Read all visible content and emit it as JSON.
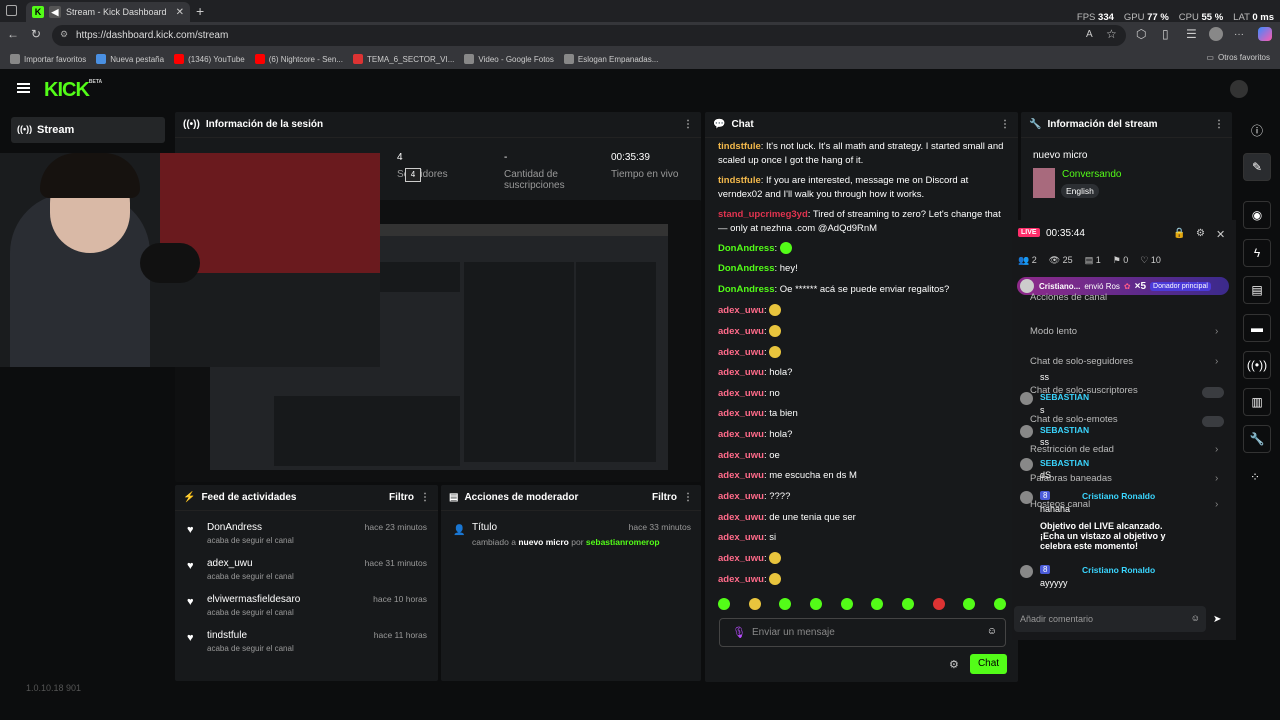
{
  "browser": {
    "tab_title": "Stream - Kick Dashboard",
    "url": "https://dashboard.kick.com/stream",
    "stats": [
      {
        "k": "FPS",
        "v": "334"
      },
      {
        "k": "GPU",
        "v": "77 %"
      },
      {
        "k": "CPU",
        "v": "55 %"
      },
      {
        "k": "LAT",
        "v": "0 ms"
      }
    ],
    "bookmarks": [
      "Importar favoritos",
      "Nueva pestaña",
      "(1346) YouTube",
      "(6) Nightcore - Sen...",
      "TEMA_6_SECTOR_VI...",
      "Video - Google Fotos",
      "Eslogan Empanadas..."
    ],
    "other_bookmarks": "Otros favoritos"
  },
  "kick": {
    "logo": "KICK",
    "beta": "BETA",
    "nav_stream": "Stream"
  },
  "session": {
    "title": "Información de la sesión",
    "followers_value": "4",
    "followers_label": "Seguidores",
    "subs_value": "-",
    "subs_label": "Cantidad de suscripciones",
    "live_value": "00:35:39",
    "live_label": "Tiempo en vivo",
    "tooltip": "4"
  },
  "feed": {
    "title": "Feed de actividades",
    "filter": "Filtro",
    "items": [
      {
        "name": "DonAndress",
        "sub": "acaba de seguir el canal",
        "time": "hace 23 minutos"
      },
      {
        "name": "adex_uwu",
        "sub": "acaba de seguir el canal",
        "time": "hace 31 minutos"
      },
      {
        "name": "elviwermasfieldesaro",
        "sub": "acaba de seguir el canal",
        "time": "hace 10 horas"
      },
      {
        "name": "tindstfule",
        "sub": "acaba de seguir el canal",
        "time": "hace 11 horas"
      }
    ]
  },
  "mod": {
    "title": "Acciones de moderador",
    "filter": "Filtro",
    "item_title": "Título",
    "item_time": "hace 33 minutos",
    "item_desc_a": "cambiado a",
    "item_desc_b": "nuevo micro",
    "item_desc_c": "por",
    "item_user": "sebastianromerop"
  },
  "chat": {
    "title": "Chat",
    "placeholder": "Enviar un mensaje",
    "send": "Chat",
    "messages": [
      {
        "u": "tindstfule",
        "c": "#f2b84b",
        "t": "It's not luck. It's all math and strategy. I started small and scaled up once I got the hang of it."
      },
      {
        "u": "tindstfule",
        "c": "#f2b84b",
        "t": "If you are interested, message me on Discord at verndex02 and I'll walk you through how it works."
      },
      {
        "u": "stand_upcrimeg3yd",
        "c": "#e0334f",
        "t": "Tired of streaming to zero? Let's change that — only at nezhna .com @AdQd9RnM"
      },
      {
        "u": "DonAndress",
        "c": "#53fc18",
        "t": ""
      },
      {
        "u": "DonAndress",
        "c": "#53fc18",
        "t": "hey!"
      },
      {
        "u": "DonAndress",
        "c": "#53fc18",
        "t": "Oe ****** acá se puede enviar regalitos?"
      },
      {
        "u": "adex_uwu",
        "c": "#ff6b8a",
        "t": ""
      },
      {
        "u": "adex_uwu",
        "c": "#ff6b8a",
        "t": ""
      },
      {
        "u": "adex_uwu",
        "c": "#ff6b8a",
        "t": ""
      },
      {
        "u": "adex_uwu",
        "c": "#ff6b8a",
        "t": "hola?"
      },
      {
        "u": "adex_uwu",
        "c": "#ff6b8a",
        "t": "no"
      },
      {
        "u": "adex_uwu",
        "c": "#ff6b8a",
        "t": "ta bien"
      },
      {
        "u": "adex_uwu",
        "c": "#ff6b8a",
        "t": "hola?"
      },
      {
        "u": "adex_uwu",
        "c": "#ff6b8a",
        "t": "oe"
      },
      {
        "u": "adex_uwu",
        "c": "#ff6b8a",
        "t": "me escucha en ds M"
      },
      {
        "u": "adex_uwu",
        "c": "#ff6b8a",
        "t": "????"
      },
      {
        "u": "adex_uwu",
        "c": "#ff6b8a",
        "t": "de une tenia que ser"
      },
      {
        "u": "adex_uwu",
        "c": "#ff6b8a",
        "t": "si"
      },
      {
        "u": "adex_uwu",
        "c": "#ff6b8a",
        "t": ""
      },
      {
        "u": "adex_uwu",
        "c": "#ff6b8a",
        "t": ""
      }
    ]
  },
  "stream_info": {
    "title": "Información del stream",
    "stream_title": "nuevo micro",
    "category": "Conversando",
    "language": "English"
  },
  "overlay": {
    "live": "LIVE",
    "time": "00:35:44",
    "viewers": "2",
    "views": "25",
    "c1": "1",
    "c2": "0",
    "likes": "10",
    "gift_user": "Cristiano...",
    "gift_text": "envió Ros",
    "gift_mult": "×5",
    "gift_badge": "Donador principal",
    "settings": [
      "Acciones de canal",
      "Modo lento",
      "Chat de solo-seguidores",
      "Chat de solo-suscriptores",
      "Chat de solo-emotes",
      "Restricción de edad",
      "Palabras baneadas",
      "Hosteos canal"
    ],
    "comments": [
      {
        "u": "",
        "t": "ss"
      },
      {
        "u": "SEBASTIAN",
        "t": "s"
      },
      {
        "u": "SEBASTIAN",
        "t": "ss"
      },
      {
        "u": "SEBASTIAN",
        "t": "dS"
      },
      {
        "u": "Cristiano Ronaldo",
        "t": "hahaha",
        "b": "8"
      },
      {
        "u": "",
        "t": "Objetivo del LIVE alcanzado. ¡Echa un vistazo al objetivo y celebra este momento!"
      },
      {
        "u": "Cristiano Ronaldo",
        "t": "ayyyyy",
        "b": "8"
      }
    ],
    "comment_placeholder": "Añadir comentario"
  },
  "footer": {
    "version": "1.0.10.18 901"
  }
}
